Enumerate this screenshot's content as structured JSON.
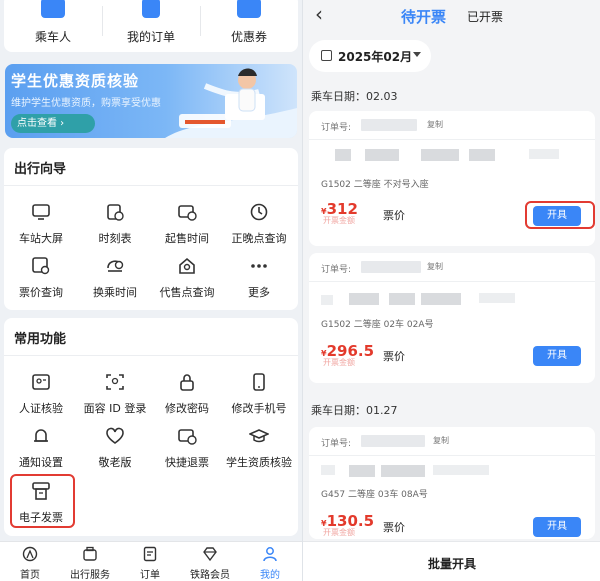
{
  "left": {
    "top_items": [
      {
        "label": "乘车人",
        "icon": "passenger-card-icon"
      },
      {
        "label": "我的订单",
        "icon": "order-document-icon"
      },
      {
        "label": "优惠券",
        "icon": "coupon-icon"
      }
    ],
    "banner": {
      "title": "学生优惠资质核验",
      "subtitle": "维护学生优惠资质，购票享受优惠",
      "button": "点击查看"
    },
    "travel_guide": {
      "title": "出行向导",
      "items": [
        {
          "label": "车站大屏",
          "icon": "station-screen-icon"
        },
        {
          "label": "时刻表",
          "icon": "timetable-icon"
        },
        {
          "label": "起售时间",
          "icon": "sale-time-icon"
        },
        {
          "label": "正晚点查询",
          "icon": "clock-icon"
        },
        {
          "label": "票价查询",
          "icon": "fare-search-icon"
        },
        {
          "label": "换乘时间",
          "icon": "transfer-time-icon"
        },
        {
          "label": "代售点查询",
          "icon": "agency-search-icon"
        },
        {
          "label": "更多",
          "icon": "more-dots-icon"
        }
      ]
    },
    "common": {
      "title": "常用功能",
      "items": [
        {
          "label": "人证核验",
          "icon": "id-verify-icon"
        },
        {
          "label": "面容 ID 登录",
          "icon": "face-id-icon"
        },
        {
          "label": "修改密码",
          "icon": "lock-icon"
        },
        {
          "label": "修改手机号",
          "icon": "phone-icon"
        },
        {
          "label": "通知设置",
          "icon": "bell-icon"
        },
        {
          "label": "敬老版",
          "icon": "heart-icon"
        },
        {
          "label": "快捷退票",
          "icon": "quick-refund-icon"
        },
        {
          "label": "学生资质核验",
          "icon": "graduation-cap-icon"
        },
        {
          "label": "电子发票",
          "icon": "e-invoice-icon"
        }
      ]
    },
    "bottom_nav": [
      {
        "label": "首页",
        "icon": "home-icon"
      },
      {
        "label": "出行服务",
        "icon": "travel-service-icon"
      },
      {
        "label": "订单",
        "icon": "order-icon"
      },
      {
        "label": "铁路会员",
        "icon": "member-diamond-icon"
      },
      {
        "label": "我的",
        "icon": "profile-icon",
        "active": true
      }
    ],
    "accent_color": "#3a86f7",
    "highlight_color": "#e23b32"
  },
  "right": {
    "tabs": {
      "active": "待开票",
      "inactive": "已开票"
    },
    "month": "2025年02月",
    "groups": [
      {
        "date_label": "乘车日期：",
        "date": "02.03",
        "tickets": [
          {
            "order_label": "订单号:",
            "copy": "复制",
            "train": "G1502 二等座   不对号入座",
            "yen": "¥",
            "price": "312",
            "stamp": "开票金额",
            "price_label": "票价",
            "button": "开具"
          },
          {
            "order_label": "订单号:",
            "copy": "复制",
            "train": "G1502 二等座 02车 02A号",
            "yen": "¥",
            "price": "296.5",
            "stamp": "开票金额",
            "price_label": "票价",
            "button": "开具"
          }
        ]
      },
      {
        "date_label": "乘车日期：",
        "date": "01.27",
        "tickets": [
          {
            "order_label": "订单号:",
            "copy": "复制",
            "train": "G457 二等座 03车 08A号",
            "yen": "¥",
            "price": "130.5",
            "stamp": "开票金额",
            "price_label": "票价",
            "button": "开具"
          }
        ]
      }
    ],
    "batch_button": "批量开具",
    "price_color": "#e33a2c",
    "highlight_color": "#e23b32"
  }
}
